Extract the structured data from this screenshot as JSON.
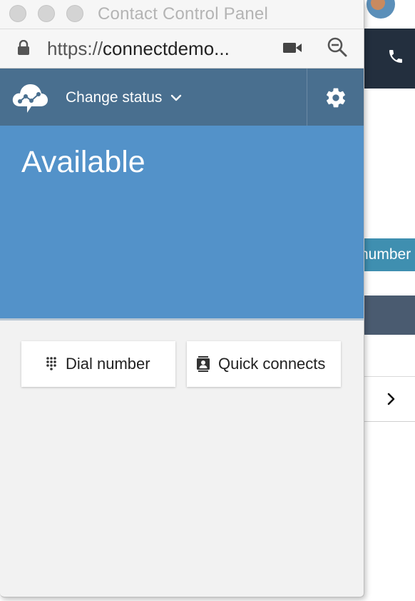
{
  "window": {
    "title": "Contact Control Panel",
    "url_scheme": "https://",
    "url_rest": "connectdemo..."
  },
  "header": {
    "status_menu_label": "Change status",
    "icons": [
      "cloud-network-logo-icon",
      "chevron-down-icon",
      "gear-icon"
    ]
  },
  "agent_status": {
    "label": "Available",
    "color": "#5392c9"
  },
  "actions": {
    "dial_label": "Dial number",
    "quick_label": "Quick connects"
  },
  "background_page": {
    "partial_button_text": "number"
  },
  "colors": {
    "header": "#496f8f",
    "status": "#5392c9",
    "panel": "#f2f2f2",
    "bg_topbar": "#232f3e",
    "bg_pill": "#3f8fb0"
  }
}
